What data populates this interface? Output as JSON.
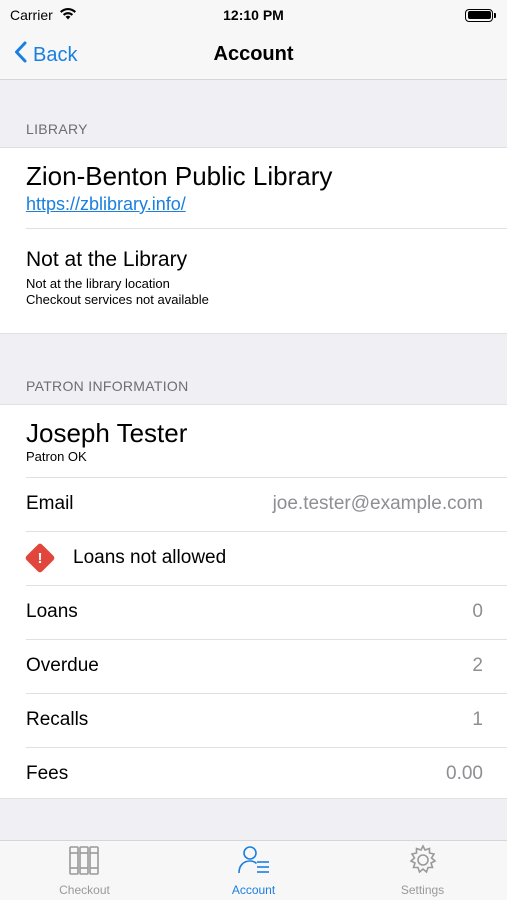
{
  "status_bar": {
    "carrier": "Carrier",
    "time": "12:10 PM"
  },
  "nav": {
    "back_label": "Back",
    "title": "Account"
  },
  "library_section": {
    "header": "LIBRARY",
    "library_name": "Zion-Benton Public Library",
    "library_url": "https://zblibrary.info/",
    "location_title": "Not at the Library",
    "location_line1": "Not at the library location",
    "location_line2": "Checkout services not available"
  },
  "patron_section": {
    "header": "PATRON INFORMATION",
    "name": "Joseph Tester",
    "status": "Patron OK",
    "email_label": "Email",
    "email_value": "joe.tester@example.com",
    "warning": "Loans not allowed",
    "rows": [
      {
        "label": "Loans",
        "value": "0"
      },
      {
        "label": "Overdue",
        "value": "2"
      },
      {
        "label": "Recalls",
        "value": "1"
      },
      {
        "label": "Fees",
        "value": "0.00"
      }
    ]
  },
  "tabs": [
    {
      "label": "Checkout",
      "icon": "books-icon",
      "active": false
    },
    {
      "label": "Account",
      "icon": "person-list-icon",
      "active": true
    },
    {
      "label": "Settings",
      "icon": "gear-icon",
      "active": false
    }
  ],
  "colors": {
    "accent": "#1a7fe0",
    "warning": "#e0463c",
    "secondary_text": "#8e8e93"
  }
}
